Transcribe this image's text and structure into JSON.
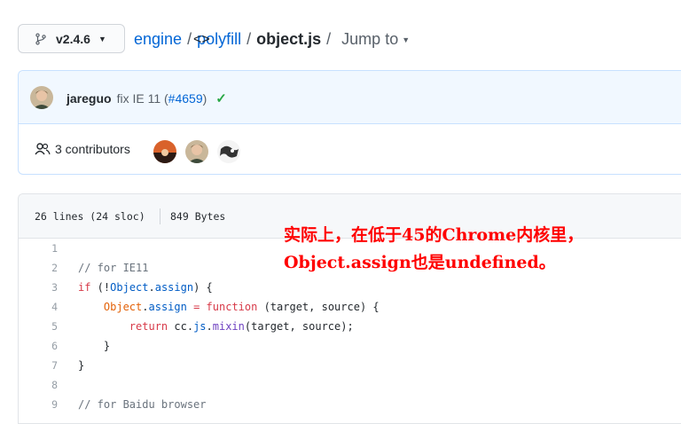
{
  "branch": {
    "label": "v2.4.6",
    "icon": "git-branch-icon"
  },
  "breadcrumb": {
    "repo": "engine",
    "folder": "polyfill",
    "file": "object.js",
    "jump_label": "Jump to"
  },
  "commit": {
    "author": "jareguo",
    "message": "fix IE 11 (",
    "pr": "#4659",
    "close": ")",
    "status": "success"
  },
  "contributors": {
    "label": "3 contributors",
    "count": 3
  },
  "file_info": {
    "lines": "26 lines (24 sloc)",
    "size": "849 Bytes"
  },
  "code": {
    "line_numbers": [
      "1",
      "2",
      "3",
      "4",
      "5",
      "6",
      "7",
      "8",
      "9"
    ],
    "lines": [
      [],
      [
        {
          "t": "// for IE11",
          "c": "c-com"
        }
      ],
      [
        {
          "t": "if",
          "c": "c-kw"
        },
        {
          "t": " (!",
          "c": ""
        },
        {
          "t": "Object",
          "c": "c-prop"
        },
        {
          "t": ".",
          "c": ""
        },
        {
          "t": "assign",
          "c": "c-prop"
        },
        {
          "t": ") {",
          "c": ""
        }
      ],
      [
        {
          "t": "    ",
          "c": ""
        },
        {
          "t": "Object",
          "c": "c-def"
        },
        {
          "t": ".",
          "c": ""
        },
        {
          "t": "assign",
          "c": "c-prop"
        },
        {
          "t": " = ",
          "c": "c-kw"
        },
        {
          "t": "function",
          "c": "c-kw"
        },
        {
          "t": " (target, source) {",
          "c": ""
        }
      ],
      [
        {
          "t": "        ",
          "c": ""
        },
        {
          "t": "return",
          "c": "c-kw"
        },
        {
          "t": " cc.",
          "c": ""
        },
        {
          "t": "js",
          "c": "c-prop"
        },
        {
          "t": ".",
          "c": ""
        },
        {
          "t": "mixin",
          "c": "c-ent"
        },
        {
          "t": "(target, source);",
          "c": ""
        }
      ],
      [
        {
          "t": "    }",
          "c": ""
        }
      ],
      [
        {
          "t": "}",
          "c": ""
        }
      ],
      [],
      [
        {
          "t": "// for Baidu browser",
          "c": "c-com"
        }
      ]
    ]
  },
  "annotation": {
    "text": "实际上，在低于45的Chrome内核里，Object.assign也是undefined。"
  },
  "colors": {
    "link": "#0366d6",
    "success": "#28a745",
    "annotation": "#ff0000"
  }
}
